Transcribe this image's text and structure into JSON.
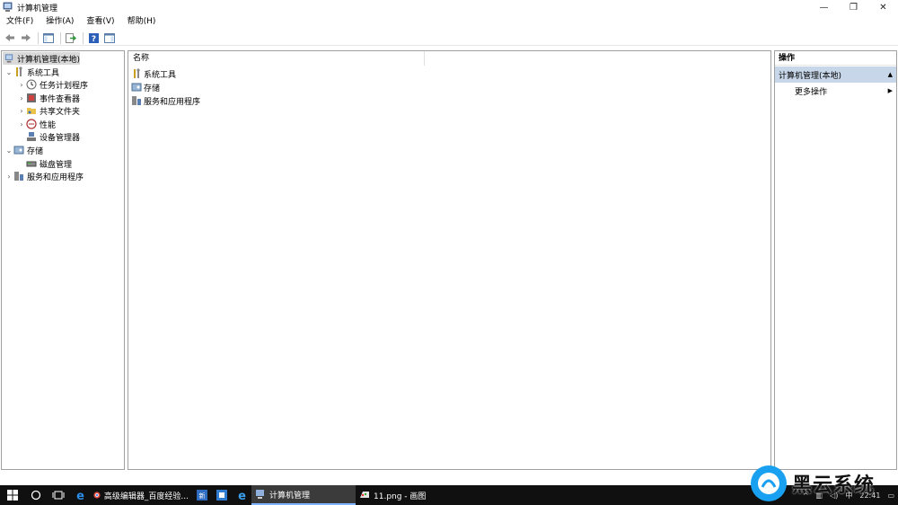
{
  "window": {
    "title": "计算机管理",
    "controls": {
      "minimize": "—",
      "restore": "❐",
      "close": "✕"
    }
  },
  "menubar": {
    "items": [
      "文件(F)",
      "操作(A)",
      "查看(V)",
      "帮助(H)"
    ]
  },
  "toolbar": {
    "buttons": [
      "back-icon",
      "forward-icon",
      "show-hide-console-tree-icon",
      "export-list-icon",
      "help-icon",
      "show-hide-action-pane-icon"
    ]
  },
  "tree": {
    "root": "计算机管理(本地)",
    "system_tools": "系统工具",
    "task_scheduler": "任务计划程序",
    "event_viewer": "事件查看器",
    "shared_folders": "共享文件夹",
    "performance": "性能",
    "device_manager": "设备管理器",
    "storage": "存储",
    "disk_management": "磁盘管理",
    "services_apps": "服务和应用程序"
  },
  "list": {
    "column_name": "名称",
    "items": [
      "系统工具",
      "存储",
      "服务和应用程序"
    ]
  },
  "actions": {
    "title": "操作",
    "group": "计算机管理(本地)",
    "more": "更多操作"
  },
  "taskbar": {
    "apps": [
      "高级编辑器_百度经验...",
      "计算机管理",
      "11.png - 画图"
    ],
    "tray_lang": "中",
    "tray_time": "22:41"
  },
  "watermark": {
    "text": "黑云系统"
  },
  "colors": {
    "selection": "#d9d9d9",
    "actions_group_bg": "#c7d6e8",
    "taskbar_bg": "#101010",
    "accent": "#1aa0f0"
  }
}
